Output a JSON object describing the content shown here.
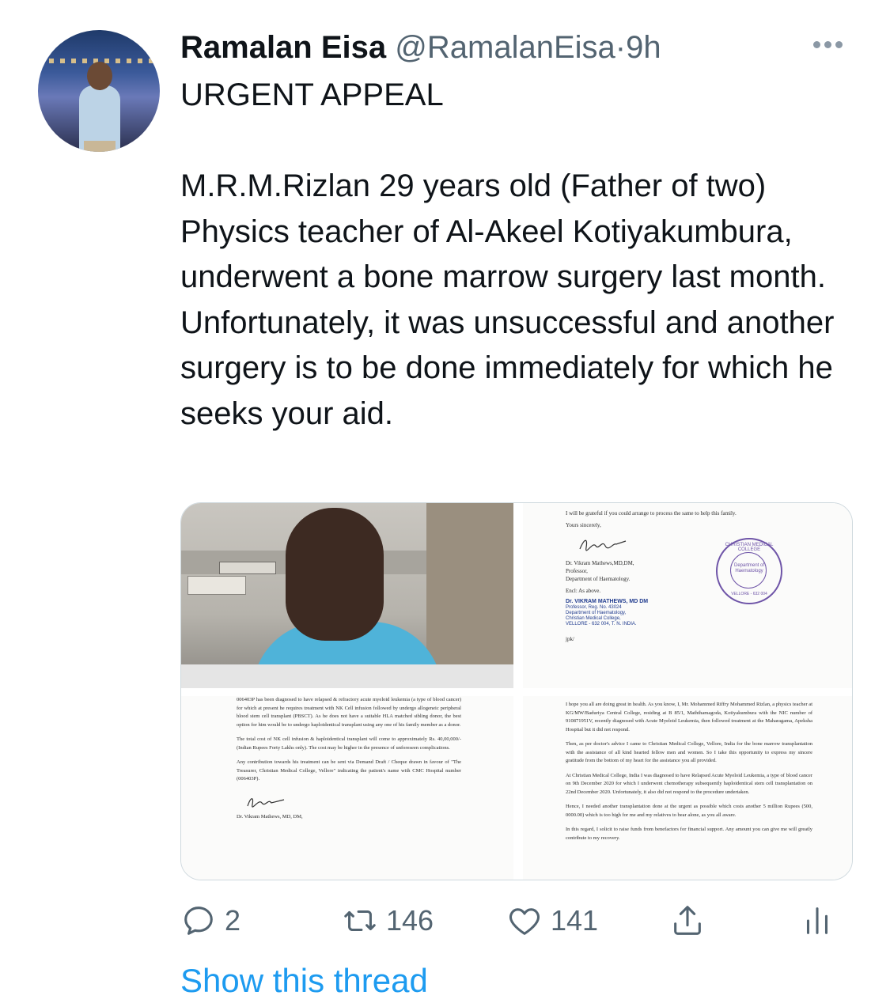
{
  "tweet": {
    "author_name": "Ramalan Eisa",
    "handle": "@RamalanEisa",
    "separator": "·",
    "time": "9h",
    "text": "URGENT APPEAL\n\nM.R.M.Rizlan 29 years old (Father of two) Physics teacher of Al-Akeel Kotiyakumbura, underwent a bone marrow surgery last month. Unfortunately, it was unsuccessful and another surgery is to be done immediately for which he seeks your aid."
  },
  "media": {
    "doc_top_right": {
      "l1": "I will be grateful if you could arrange to process the same to help this family.",
      "l2": "Yours sincerely,",
      "l3": "Dr. Vikram Mathews,MD,DM,",
      "l4": "Professor,",
      "l5": "Department of Haematology.",
      "l6": "Encl: As above.",
      "s1": "Dr. VIKRAM MATHEWS, MD  DM",
      "s2": "Professor, Reg. No. 43024",
      "s3": "Department of Haematology,",
      "s4": "Christian Medical College,",
      "s5": "VELLORE - 632 004, T. N.  INDIA.",
      "l7": "jpk/",
      "seal_ring": "CHRISTIAN MEDICAL COLLEGE",
      "seal_mid": "Department of Haematology",
      "seal_bottom": "VELLORE - 632 004"
    },
    "doc_bottom_left": {
      "p1": "006403P has been diagnosed to have relapsed & refractory acute myeloid leukemia (a type of blood cancer) for which at present he requires treatment with NK Cell infusion followed by undergo allogeneic peripheral blood stem cell transplant (PBSCT). As he does not have a suitable HLA matched sibling donor, the best option for him would be to undergo haploidentical transplant using any one of his family member as a donor.",
      "p2": "The total cost of NK cell infusion & haploidentical transplant will come to approximately Rs. 40,00,000/- (Indian Rupees Forty Lakhs only). The cost may be higher in the presence of unforeseen complications.",
      "p3": "Any contribution towards his treatment can be sent via Demand Draft / Cheque drawn in favour of \"The Treasurer, Christian Medical College, Vellore\" indicating the patient's name with CMC Hospital number (006403P).",
      "sign": "Dr. Vikram Mathews, MD, DM,"
    },
    "doc_bottom_right": {
      "p1": "I hope you all are doing great in health. As you know, I, Mr. Mohammed Riffry Mohammed Rizlan, a physics teacher at KG/MW/Baduriya Central College, residing at B 85/1, Maththamagoda, Kotiyakumbura with the NIC number of 910871951V, recently diagnosed with Acute Myeloid Leukemia, then followed treatment at the Maharagama, Apeksha Hospital but it did not respond.",
      "p2": "Then, as per doctor's advice I came to Christian Medical College, Vellore, India for the bone marrow transplantation with the assistance of all kind hearted fellow men and women. So I take this opportunity to express my sincere gratitude from the bottom of my heart for the assistance you all provided.",
      "p3": "At Christian Medical College, India I was diagnosed to have Relapsed Acute Myeloid Leukemia, a type of blood cancer on 9th December 2020 for which I underwent chemotherapy subsequently haploidentical stem cell transplantation on 22nd December 2020. Unfortunately, it also did not respond to the procedure undertaken.",
      "p4": "Hence, I needed another transplantation done at the urgent as possible which costs another 5 million Rupees (500, 0000.00) which is too high for me and my relatives to bear alone, as you all aware.",
      "p5": "In this regard, I solicit to raise funds from benefactors for financial support. Any amount you can give me will greatly contribute to my recovery."
    }
  },
  "actions": {
    "replies": "2",
    "retweets": "146",
    "likes": "141"
  },
  "show_thread": "Show this thread",
  "colors": {
    "link": "#1d9bf0",
    "muted": "#536471",
    "text": "#0f1419"
  },
  "icons": [
    "reply-icon",
    "retweet-icon",
    "like-icon",
    "share-icon",
    "analytics-icon",
    "more-icon"
  ]
}
